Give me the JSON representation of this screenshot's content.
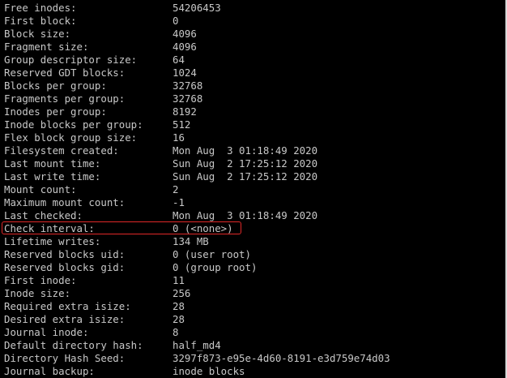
{
  "lines": [
    {
      "key": "Free inodes:",
      "value": "54206453"
    },
    {
      "key": "First block:",
      "value": "0"
    },
    {
      "key": "Block size:",
      "value": "4096"
    },
    {
      "key": "Fragment size:",
      "value": "4096"
    },
    {
      "key": "Group descriptor size:",
      "value": "64"
    },
    {
      "key": "Reserved GDT blocks:",
      "value": "1024"
    },
    {
      "key": "Blocks per group:",
      "value": "32768"
    },
    {
      "key": "Fragments per group:",
      "value": "32768"
    },
    {
      "key": "Inodes per group:",
      "value": "8192"
    },
    {
      "key": "Inode blocks per group:",
      "value": "512"
    },
    {
      "key": "Flex block group size:",
      "value": "16"
    },
    {
      "key": "Filesystem created:",
      "value": "Mon Aug  3 01:18:49 2020"
    },
    {
      "key": "Last mount time:",
      "value": "Sun Aug  2 17:25:12 2020"
    },
    {
      "key": "Last write time:",
      "value": "Sun Aug  2 17:25:12 2020"
    },
    {
      "key": "Mount count:",
      "value": "2"
    },
    {
      "key": "Maximum mount count:",
      "value": "-1"
    },
    {
      "key": "Last checked:",
      "value": "Mon Aug  3 01:18:49 2020"
    },
    {
      "key": "Check interval:",
      "value": "0 (<none>)"
    },
    {
      "key": "Lifetime writes:",
      "value": "134 MB"
    },
    {
      "key": "Reserved blocks uid:",
      "value": "0 (user root)"
    },
    {
      "key": "Reserved blocks gid:",
      "value": "0 (group root)"
    },
    {
      "key": "First inode:",
      "value": "11"
    },
    {
      "key": "Inode size:",
      "value": "256"
    },
    {
      "key": "Required extra isize:",
      "value": "28"
    },
    {
      "key": "Desired extra isize:",
      "value": "28"
    },
    {
      "key": "Journal inode:",
      "value": "8"
    },
    {
      "key": "Default directory hash:",
      "value": "half_md4"
    },
    {
      "key": "Directory Hash Seed:",
      "value": "3297f873-e95e-4d60-8191-e3d759e74d03"
    },
    {
      "key": "Journal backup:",
      "value": "inode blocks"
    }
  ],
  "highlighted_line": "Check interval:",
  "colors": {
    "background": "#000000",
    "text": "#c8c8c8",
    "highlight": "#e02828"
  }
}
